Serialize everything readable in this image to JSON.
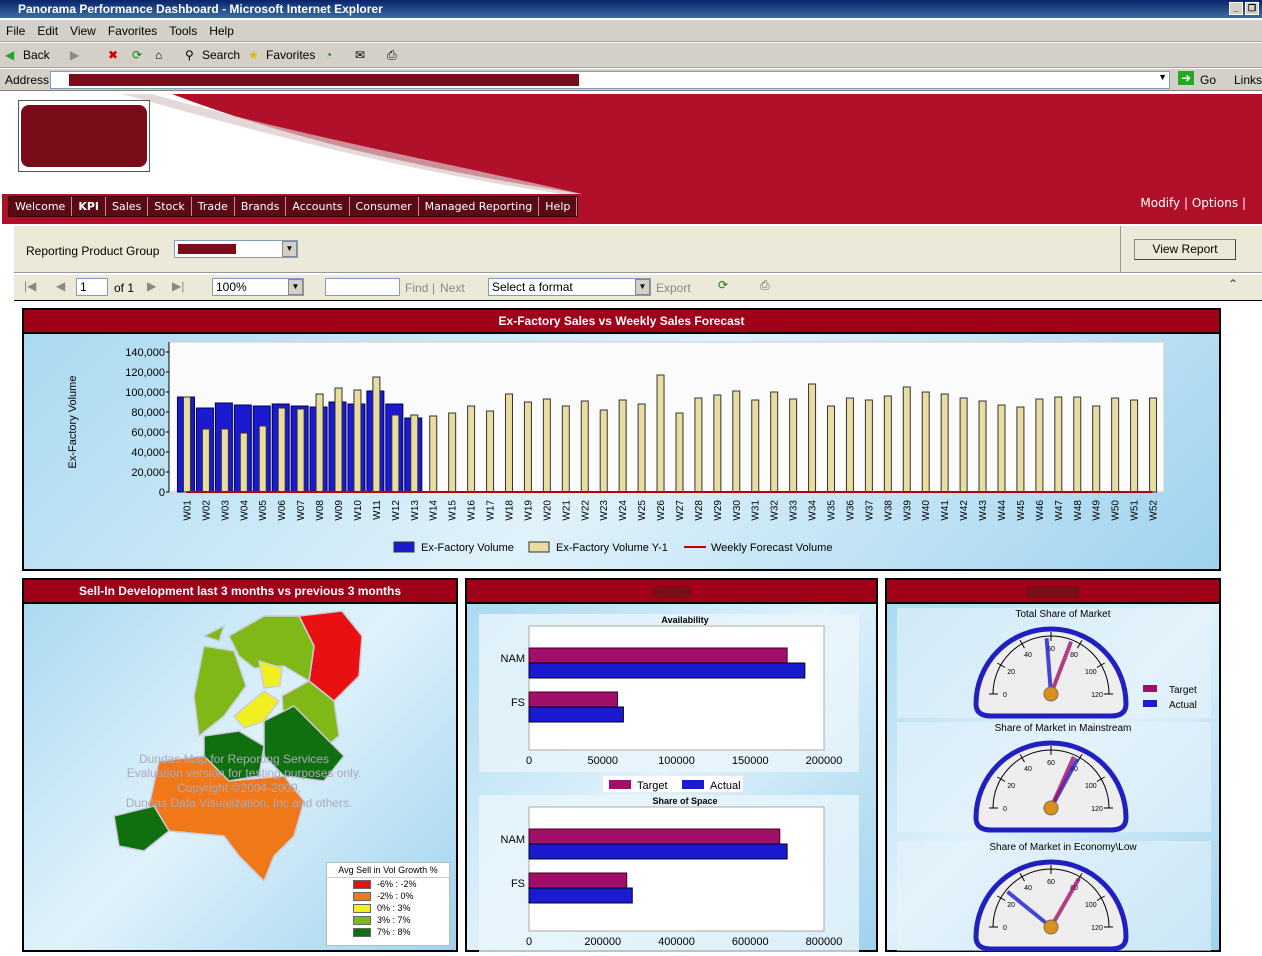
{
  "window": {
    "title": "Panorama Performance Dashboard - Microsoft Internet Explorer"
  },
  "menu": [
    "File",
    "Edit",
    "View",
    "Favorites",
    "Tools",
    "Help"
  ],
  "toolbar": {
    "back": "Back",
    "search": "Search",
    "favorites": "Favorites"
  },
  "address": {
    "label": "Address",
    "go": "Go",
    "links": "Links"
  },
  "nav": {
    "items": [
      "Welcome",
      "KPI",
      "Sales",
      "Stock",
      "Trade",
      "Brands",
      "Accounts",
      "Consumer",
      "Managed Reporting",
      "Help"
    ],
    "active": "KPI",
    "right": [
      "Modify",
      "Options"
    ]
  },
  "params": {
    "label": "Reporting Product Group",
    "view_report": "View Report"
  },
  "report_toolbar": {
    "page": "1",
    "of": "of 1",
    "zoom": "100%",
    "find": "Find",
    "next": "Next",
    "format": "Select a format",
    "export": "Export"
  },
  "colors": {
    "brand": "#b0102a",
    "actual": "#1a1ad0",
    "prior": "#e8dca0",
    "forecast": "#c00000",
    "target": "#a0106a"
  },
  "chart_data": [
    {
      "type": "bar",
      "title": "Ex-Factory Sales vs Weekly Sales Forecast",
      "ylabel": "Ex-Factory Volume",
      "ylim": [
        0,
        140000
      ],
      "yticks": [
        "0",
        "20,000",
        "40,000",
        "60,000",
        "80,000",
        "100,000",
        "120,000",
        "140,000"
      ],
      "categories": [
        "W01",
        "W02",
        "W03",
        "W04",
        "W05",
        "W06",
        "W07",
        "W08",
        "W09",
        "W10",
        "W11",
        "W12",
        "W13",
        "W14",
        "W15",
        "W16",
        "W17",
        "W18",
        "W19",
        "W20",
        "W21",
        "W22",
        "W23",
        "W24",
        "W25",
        "W26",
        "W27",
        "W28",
        "W29",
        "W30",
        "W31",
        "W32",
        "W33",
        "W34",
        "W35",
        "W36",
        "W37",
        "W38",
        "W39",
        "W40",
        "W41",
        "W42",
        "W43",
        "W44",
        "W45",
        "W46",
        "W47",
        "W48",
        "W49",
        "W50",
        "W51",
        "W52"
      ],
      "series": [
        {
          "name": "Ex-Factory Volume",
          "values": [
            95000,
            84000,
            89000,
            87000,
            86000,
            88000,
            86000,
            85000,
            90000,
            88000,
            101000,
            88000,
            74000
          ]
        },
        {
          "name": "Ex-Factory Volume Y-1",
          "values": [
            95000,
            63000,
            63000,
            59000,
            66000,
            84000,
            83000,
            98000,
            104000,
            102000,
            115000,
            77000,
            77000,
            76000,
            79000,
            86000,
            81000,
            98000,
            90000,
            93000,
            86000,
            91000,
            82000,
            92000,
            88000,
            117000,
            79000,
            94000,
            97000,
            101000,
            92000,
            100000,
            93000,
            108000,
            86000,
            94000,
            92000,
            96000,
            105000,
            100000,
            98000,
            94000,
            91000,
            87000,
            85000,
            93000,
            95000,
            95000,
            86000,
            94000,
            92000,
            94000
          ]
        },
        {
          "name": "Weekly Forecast Volume",
          "type": "line",
          "values": [
            0,
            0,
            0,
            0,
            0,
            0,
            0,
            0,
            0,
            0,
            0,
            0,
            0,
            0,
            0,
            0,
            0,
            0,
            0,
            0,
            0,
            0,
            0,
            0,
            0,
            0,
            0,
            0,
            0,
            0,
            0,
            0,
            0,
            0,
            0,
            0,
            0,
            0,
            0,
            0,
            0,
            0,
            0,
            0,
            0,
            0,
            0,
            0,
            0,
            0,
            0,
            0
          ]
        }
      ],
      "legend": "bottom",
      "grid": false
    },
    {
      "type": "bar",
      "orientation": "horizontal",
      "title": "Availability",
      "categories": [
        "NAM",
        "FS"
      ],
      "xlim": [
        0,
        200000
      ],
      "xticks": [
        "0",
        "50000",
        "100000",
        "150000",
        "200000"
      ],
      "series": [
        {
          "name": "Target",
          "values": [
            175000,
            60000
          ]
        },
        {
          "name": "Actual",
          "values": [
            187000,
            64000
          ]
        }
      ],
      "legend": "bottom"
    },
    {
      "type": "bar",
      "orientation": "horizontal",
      "title": "Share of Space",
      "categories": [
        "NAM",
        "FS"
      ],
      "xlim": [
        0,
        800000
      ],
      "xticks": [
        "0",
        "200000",
        "400000",
        "600000",
        "800000"
      ],
      "series": [
        {
          "name": "Target",
          "values": [
            680000,
            265000
          ]
        },
        {
          "name": "Actual",
          "values": [
            700000,
            280000
          ]
        }
      ]
    },
    {
      "type": "gauge",
      "range": [
        0,
        120
      ],
      "ticks": [
        "0",
        "20",
        "40",
        "60",
        "80",
        "100",
        "120"
      ],
      "legend": [
        "Target",
        "Actual"
      ],
      "gauges": [
        {
          "title": "Total Share of Market",
          "target": 74,
          "actual": 57
        },
        {
          "title": "Share of Market in Mainstream",
          "target": 76,
          "actual": 79
        },
        {
          "title": "Share of Market in Economy\\Low",
          "target": 80,
          "actual": 26
        }
      ]
    }
  ],
  "map": {
    "title": "Sell-In Development last 3 months vs previous 3 months",
    "watermark": [
      "Dundas Map for Reporting Services",
      "Evaluation version for testing purposes only.",
      "Copyright ©2004-2009,",
      "Dundas Data Visualization, Inc and others."
    ],
    "legend_title": "Avg Sell in Vol Growth %",
    "legend": [
      {
        "label": "-6% : -2%",
        "color": "#e81010"
      },
      {
        "label": "-2% : 0%",
        "color": "#f07818"
      },
      {
        "label": "0% : 3%",
        "color": "#f0f020"
      },
      {
        "label": "3% : 7%",
        "color": "#80b818"
      },
      {
        "label": "7% : 8%",
        "color": "#107010"
      }
    ]
  }
}
